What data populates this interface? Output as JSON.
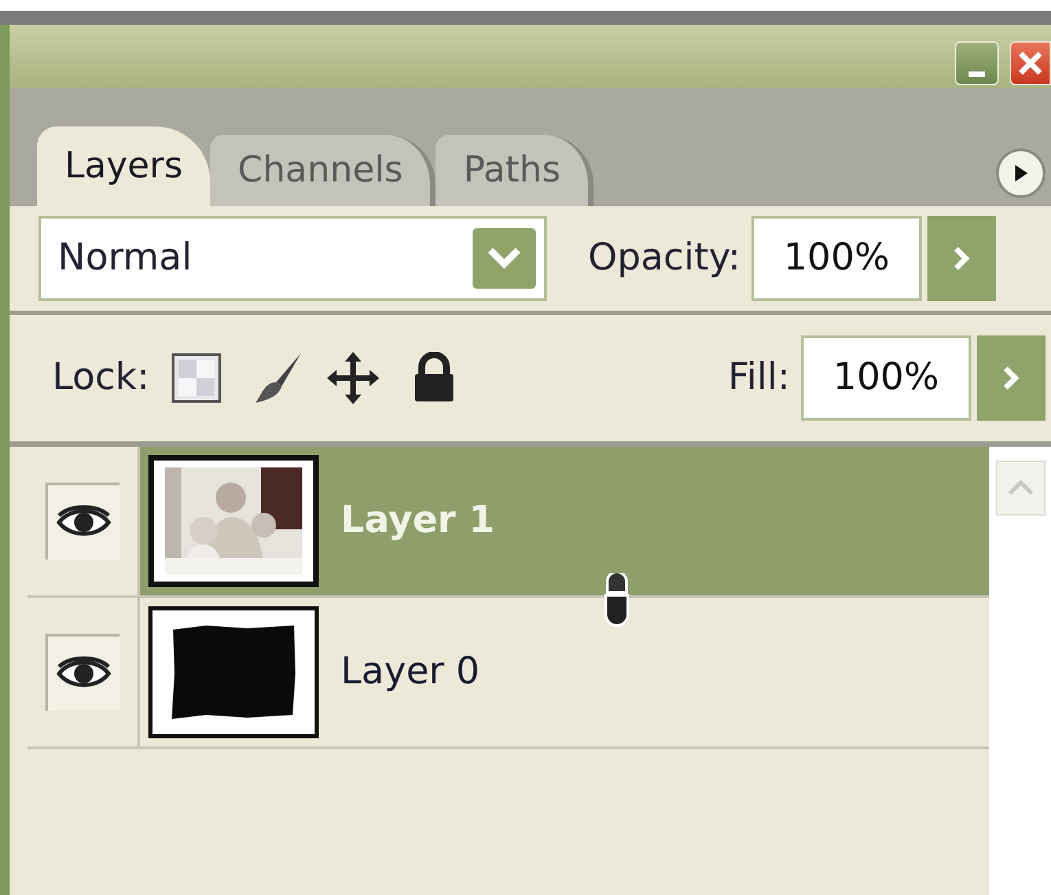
{
  "tabs": [
    {
      "label": "Layers",
      "selected": true
    },
    {
      "label": "Channels",
      "selected": false
    },
    {
      "label": "Paths",
      "selected": false
    }
  ],
  "blend_mode": {
    "value": "Normal"
  },
  "opacity": {
    "label": "Opacity:",
    "value": "100%"
  },
  "lock": {
    "label": "Lock:"
  },
  "fill": {
    "label": "Fill:",
    "value": "100%"
  },
  "layers": [
    {
      "name": "Layer 1",
      "selected": true,
      "visible": true
    },
    {
      "name": "Layer 0",
      "selected": false,
      "visible": true,
      "thumbnail": {
        "kind": "mask"
      }
    }
  ]
}
